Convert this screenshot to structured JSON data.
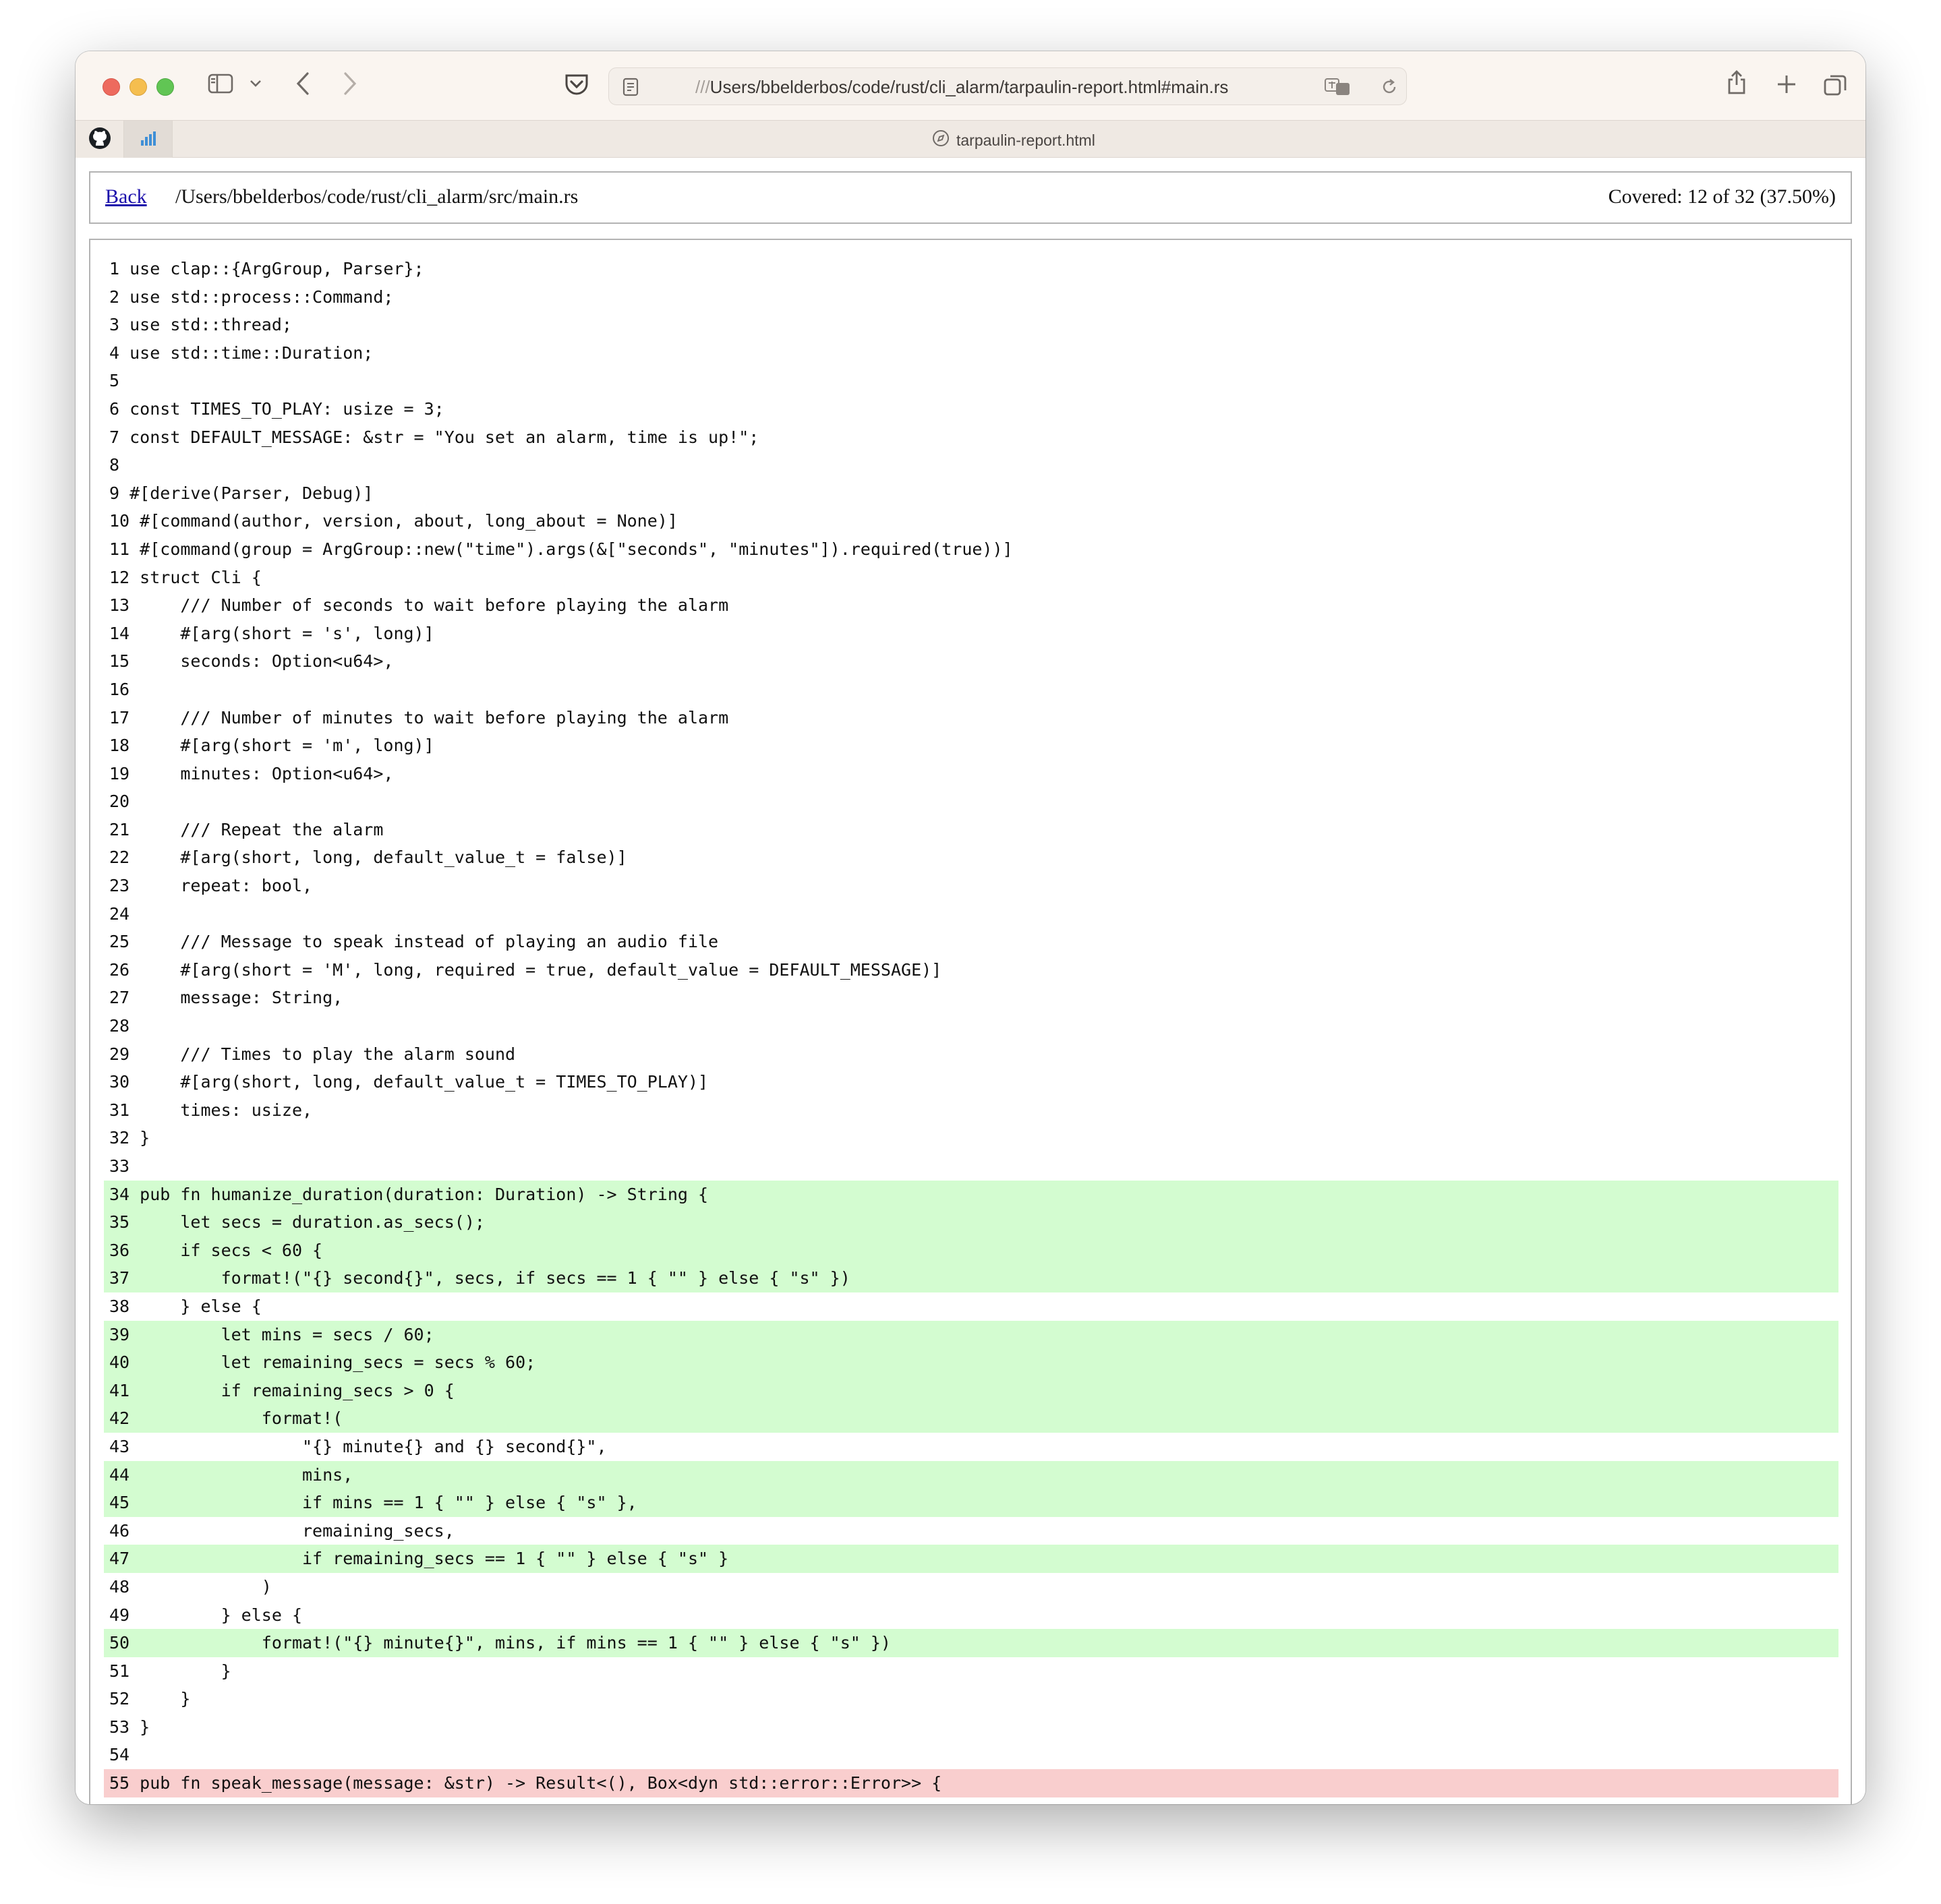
{
  "browser": {
    "address": {
      "prefix": "///",
      "path": "Users/bbelderbos/code/rust/cli_alarm/tarpaulin-report.html#main.rs"
    },
    "tab_title": "tarpaulin-report.html"
  },
  "report": {
    "back_label": "Back",
    "file_path": "/Users/bbelderbos/code/rust/cli_alarm/src/main.rs",
    "coverage_text": "Covered: 12 of 32 (37.50%)"
  },
  "colors": {
    "covered": "#d3fcd0",
    "uncovered": "#f9cece",
    "link": "#1a0dab"
  },
  "lines": [
    {
      "n": "1",
      "code": "use clap::{ArgGroup, Parser};",
      "status": "none"
    },
    {
      "n": "2",
      "code": "use std::process::Command;",
      "status": "none"
    },
    {
      "n": "3",
      "code": "use std::thread;",
      "status": "none"
    },
    {
      "n": "4",
      "code": "use std::time::Duration;",
      "status": "none"
    },
    {
      "n": "5",
      "code": "",
      "status": "none"
    },
    {
      "n": "6",
      "code": "const TIMES_TO_PLAY: usize = 3;",
      "status": "none"
    },
    {
      "n": "7",
      "code": "const DEFAULT_MESSAGE: &str = \"You set an alarm, time is up!\";",
      "status": "none"
    },
    {
      "n": "8",
      "code": "",
      "status": "none"
    },
    {
      "n": "9",
      "code": "#[derive(Parser, Debug)]",
      "status": "none"
    },
    {
      "n": "10",
      "code": "#[command(author, version, about, long_about = None)]",
      "status": "none"
    },
    {
      "n": "11",
      "code": "#[command(group = ArgGroup::new(\"time\").args(&[\"seconds\", \"minutes\"]).required(true))]",
      "status": "none"
    },
    {
      "n": "12",
      "code": "struct Cli {",
      "status": "none"
    },
    {
      "n": "13",
      "code": "    /// Number of seconds to wait before playing the alarm",
      "status": "none"
    },
    {
      "n": "14",
      "code": "    #[arg(short = 's', long)]",
      "status": "none"
    },
    {
      "n": "15",
      "code": "    seconds: Option<u64>,",
      "status": "none"
    },
    {
      "n": "16",
      "code": "",
      "status": "none"
    },
    {
      "n": "17",
      "code": "    /// Number of minutes to wait before playing the alarm",
      "status": "none"
    },
    {
      "n": "18",
      "code": "    #[arg(short = 'm', long)]",
      "status": "none"
    },
    {
      "n": "19",
      "code": "    minutes: Option<u64>,",
      "status": "none"
    },
    {
      "n": "20",
      "code": "",
      "status": "none"
    },
    {
      "n": "21",
      "code": "    /// Repeat the alarm",
      "status": "none"
    },
    {
      "n": "22",
      "code": "    #[arg(short, long, default_value_t = false)]",
      "status": "none"
    },
    {
      "n": "23",
      "code": "    repeat: bool,",
      "status": "none"
    },
    {
      "n": "24",
      "code": "",
      "status": "none"
    },
    {
      "n": "25",
      "code": "    /// Message to speak instead of playing an audio file",
      "status": "none"
    },
    {
      "n": "26",
      "code": "    #[arg(short = 'M', long, required = true, default_value = DEFAULT_MESSAGE)]",
      "status": "none"
    },
    {
      "n": "27",
      "code": "    message: String,",
      "status": "none"
    },
    {
      "n": "28",
      "code": "",
      "status": "none"
    },
    {
      "n": "29",
      "code": "    /// Times to play the alarm sound",
      "status": "none"
    },
    {
      "n": "30",
      "code": "    #[arg(short, long, default_value_t = TIMES_TO_PLAY)]",
      "status": "none"
    },
    {
      "n": "31",
      "code": "    times: usize,",
      "status": "none"
    },
    {
      "n": "32",
      "code": "}",
      "status": "none"
    },
    {
      "n": "33",
      "code": "",
      "status": "none"
    },
    {
      "n": "34",
      "code": "pub fn humanize_duration(duration: Duration) -> String {",
      "status": "covered"
    },
    {
      "n": "35",
      "code": "    let secs = duration.as_secs();",
      "status": "covered"
    },
    {
      "n": "36",
      "code": "    if secs < 60 {",
      "status": "covered"
    },
    {
      "n": "37",
      "code": "        format!(\"{} second{}\", secs, if secs == 1 { \"\" } else { \"s\" })",
      "status": "covered"
    },
    {
      "n": "38",
      "code": "    } else {",
      "status": "none"
    },
    {
      "n": "39",
      "code": "        let mins = secs / 60;",
      "status": "covered"
    },
    {
      "n": "40",
      "code": "        let remaining_secs = secs % 60;",
      "status": "covered"
    },
    {
      "n": "41",
      "code": "        if remaining_secs > 0 {",
      "status": "covered"
    },
    {
      "n": "42",
      "code": "            format!(",
      "status": "covered"
    },
    {
      "n": "43",
      "code": "                \"{} minute{} and {} second{}\",",
      "status": "none"
    },
    {
      "n": "44",
      "code": "                mins,",
      "status": "covered"
    },
    {
      "n": "45",
      "code": "                if mins == 1 { \"\" } else { \"s\" },",
      "status": "covered"
    },
    {
      "n": "46",
      "code": "                remaining_secs,",
      "status": "none"
    },
    {
      "n": "47",
      "code": "                if remaining_secs == 1 { \"\" } else { \"s\" }",
      "status": "covered"
    },
    {
      "n": "48",
      "code": "            )",
      "status": "none"
    },
    {
      "n": "49",
      "code": "        } else {",
      "status": "none"
    },
    {
      "n": "50",
      "code": "            format!(\"{} minute{}\", mins, if mins == 1 { \"\" } else { \"s\" })",
      "status": "covered"
    },
    {
      "n": "51",
      "code": "        }",
      "status": "none"
    },
    {
      "n": "52",
      "code": "    }",
      "status": "none"
    },
    {
      "n": "53",
      "code": "}",
      "status": "none"
    },
    {
      "n": "54",
      "code": "",
      "status": "none"
    },
    {
      "n": "55",
      "code": "pub fn speak_message(message: &str) -> Result<(), Box<dyn std::error::Error>> {",
      "status": "uncovered"
    }
  ]
}
